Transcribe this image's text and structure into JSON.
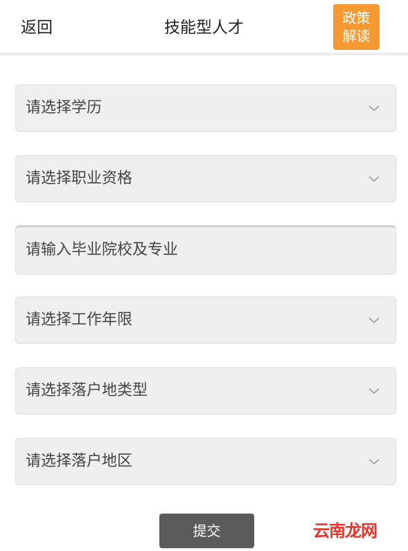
{
  "header": {
    "back_label": "返回",
    "title": "技能型人才",
    "policy_button": {
      "line1": "政策",
      "line2": "解读",
      "color": "#f59a31"
    }
  },
  "form": {
    "education_select": {
      "placeholder": "请选择学历"
    },
    "qualification_select": {
      "placeholder": "请选择职业资格"
    },
    "school_major_input": {
      "placeholder": "请输入毕业院校及专业"
    },
    "work_years_select": {
      "placeholder": "请选择工作年限"
    },
    "settlement_type_select": {
      "placeholder": "请选择落户地类型"
    },
    "settlement_region_select": {
      "placeholder": "请选择落户地区"
    }
  },
  "submit": {
    "label": "提交",
    "color": "#5b5b5b"
  },
  "watermark": {
    "text": "云南龙网",
    "color": "#e8342a"
  },
  "icons": {
    "select_chevron": "chevron-down-icon"
  }
}
